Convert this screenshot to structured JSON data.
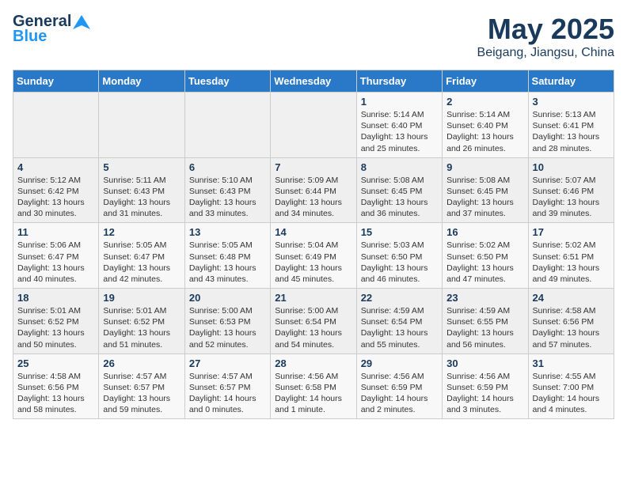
{
  "header": {
    "logo_line1": "General",
    "logo_line2": "Blue",
    "title": "May 2025",
    "subtitle": "Beigang, Jiangsu, China"
  },
  "columns": [
    "Sunday",
    "Monday",
    "Tuesday",
    "Wednesday",
    "Thursday",
    "Friday",
    "Saturday"
  ],
  "weeks": [
    [
      {
        "day": "",
        "info": ""
      },
      {
        "day": "",
        "info": ""
      },
      {
        "day": "",
        "info": ""
      },
      {
        "day": "",
        "info": ""
      },
      {
        "day": "1",
        "info": "Sunrise: 5:14 AM\nSunset: 6:40 PM\nDaylight: 13 hours\nand 25 minutes."
      },
      {
        "day": "2",
        "info": "Sunrise: 5:14 AM\nSunset: 6:40 PM\nDaylight: 13 hours\nand 26 minutes."
      },
      {
        "day": "3",
        "info": "Sunrise: 5:13 AM\nSunset: 6:41 PM\nDaylight: 13 hours\nand 28 minutes."
      }
    ],
    [
      {
        "day": "4",
        "info": "Sunrise: 5:12 AM\nSunset: 6:42 PM\nDaylight: 13 hours\nand 30 minutes."
      },
      {
        "day": "5",
        "info": "Sunrise: 5:11 AM\nSunset: 6:43 PM\nDaylight: 13 hours\nand 31 minutes."
      },
      {
        "day": "6",
        "info": "Sunrise: 5:10 AM\nSunset: 6:43 PM\nDaylight: 13 hours\nand 33 minutes."
      },
      {
        "day": "7",
        "info": "Sunrise: 5:09 AM\nSunset: 6:44 PM\nDaylight: 13 hours\nand 34 minutes."
      },
      {
        "day": "8",
        "info": "Sunrise: 5:08 AM\nSunset: 6:45 PM\nDaylight: 13 hours\nand 36 minutes."
      },
      {
        "day": "9",
        "info": "Sunrise: 5:08 AM\nSunset: 6:45 PM\nDaylight: 13 hours\nand 37 minutes."
      },
      {
        "day": "10",
        "info": "Sunrise: 5:07 AM\nSunset: 6:46 PM\nDaylight: 13 hours\nand 39 minutes."
      }
    ],
    [
      {
        "day": "11",
        "info": "Sunrise: 5:06 AM\nSunset: 6:47 PM\nDaylight: 13 hours\nand 40 minutes."
      },
      {
        "day": "12",
        "info": "Sunrise: 5:05 AM\nSunset: 6:47 PM\nDaylight: 13 hours\nand 42 minutes."
      },
      {
        "day": "13",
        "info": "Sunrise: 5:05 AM\nSunset: 6:48 PM\nDaylight: 13 hours\nand 43 minutes."
      },
      {
        "day": "14",
        "info": "Sunrise: 5:04 AM\nSunset: 6:49 PM\nDaylight: 13 hours\nand 45 minutes."
      },
      {
        "day": "15",
        "info": "Sunrise: 5:03 AM\nSunset: 6:50 PM\nDaylight: 13 hours\nand 46 minutes."
      },
      {
        "day": "16",
        "info": "Sunrise: 5:02 AM\nSunset: 6:50 PM\nDaylight: 13 hours\nand 47 minutes."
      },
      {
        "day": "17",
        "info": "Sunrise: 5:02 AM\nSunset: 6:51 PM\nDaylight: 13 hours\nand 49 minutes."
      }
    ],
    [
      {
        "day": "18",
        "info": "Sunrise: 5:01 AM\nSunset: 6:52 PM\nDaylight: 13 hours\nand 50 minutes."
      },
      {
        "day": "19",
        "info": "Sunrise: 5:01 AM\nSunset: 6:52 PM\nDaylight: 13 hours\nand 51 minutes."
      },
      {
        "day": "20",
        "info": "Sunrise: 5:00 AM\nSunset: 6:53 PM\nDaylight: 13 hours\nand 52 minutes."
      },
      {
        "day": "21",
        "info": "Sunrise: 5:00 AM\nSunset: 6:54 PM\nDaylight: 13 hours\nand 54 minutes."
      },
      {
        "day": "22",
        "info": "Sunrise: 4:59 AM\nSunset: 6:54 PM\nDaylight: 13 hours\nand 55 minutes."
      },
      {
        "day": "23",
        "info": "Sunrise: 4:59 AM\nSunset: 6:55 PM\nDaylight: 13 hours\nand 56 minutes."
      },
      {
        "day": "24",
        "info": "Sunrise: 4:58 AM\nSunset: 6:56 PM\nDaylight: 13 hours\nand 57 minutes."
      }
    ],
    [
      {
        "day": "25",
        "info": "Sunrise: 4:58 AM\nSunset: 6:56 PM\nDaylight: 13 hours\nand 58 minutes."
      },
      {
        "day": "26",
        "info": "Sunrise: 4:57 AM\nSunset: 6:57 PM\nDaylight: 13 hours\nand 59 minutes."
      },
      {
        "day": "27",
        "info": "Sunrise: 4:57 AM\nSunset: 6:57 PM\nDaylight: 14 hours\nand 0 minutes."
      },
      {
        "day": "28",
        "info": "Sunrise: 4:56 AM\nSunset: 6:58 PM\nDaylight: 14 hours\nand 1 minute."
      },
      {
        "day": "29",
        "info": "Sunrise: 4:56 AM\nSunset: 6:59 PM\nDaylight: 14 hours\nand 2 minutes."
      },
      {
        "day": "30",
        "info": "Sunrise: 4:56 AM\nSunset: 6:59 PM\nDaylight: 14 hours\nand 3 minutes."
      },
      {
        "day": "31",
        "info": "Sunrise: 4:55 AM\nSunset: 7:00 PM\nDaylight: 14 hours\nand 4 minutes."
      }
    ]
  ]
}
